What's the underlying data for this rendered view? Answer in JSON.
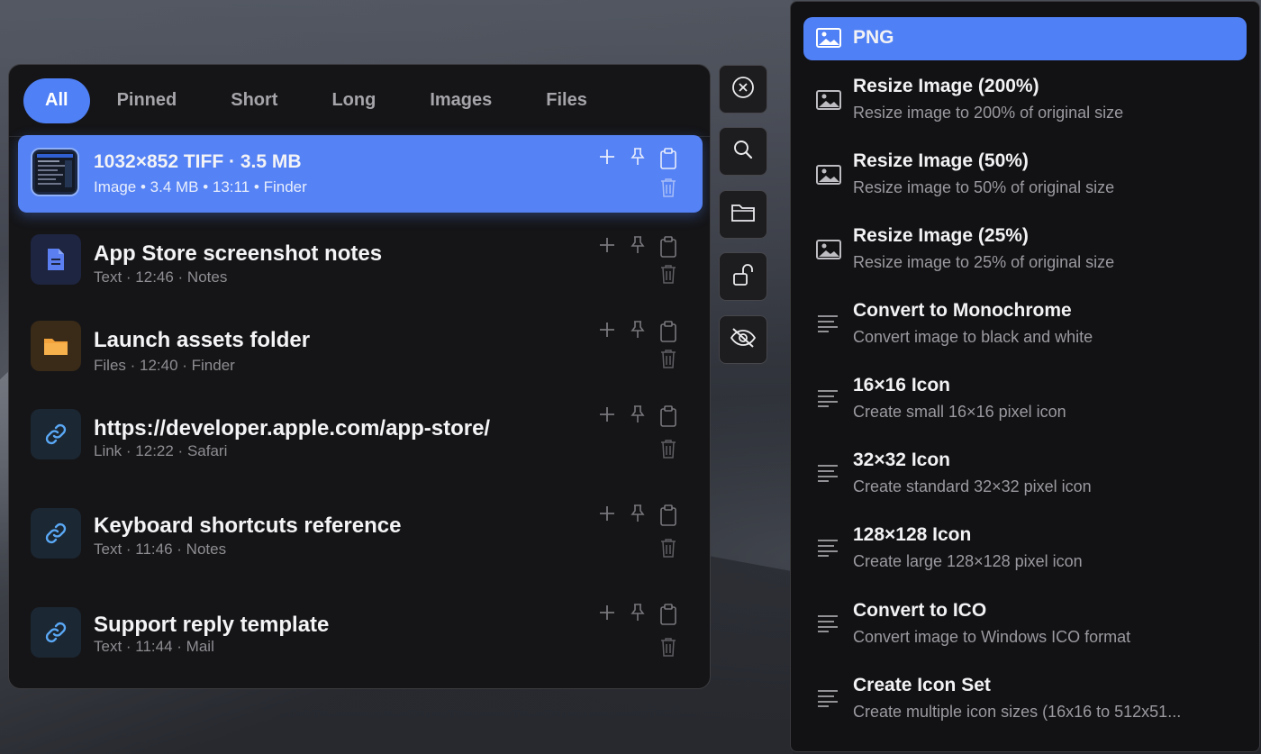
{
  "tabs": [
    "All",
    "Pinned",
    "Short",
    "Long",
    "Images",
    "Files"
  ],
  "items": [
    {
      "title": "1032×852 TIFF · 3.5 MB",
      "meta": "Image • 3.4 MB • 13:11 • Finder",
      "icon": "image-thumbnail-icon"
    },
    {
      "title": "App Store screenshot notes",
      "meta": "Text · 12:46 · Notes",
      "icon": "document-icon"
    },
    {
      "title": "Launch assets folder",
      "meta": "Files · 12:40 · Finder",
      "icon": "folder-icon"
    },
    {
      "title": "https://developer.apple.com/app-store/",
      "meta": "Link · 12:22 · Safari",
      "icon": "link-icon"
    },
    {
      "title": "Keyboard shortcuts reference",
      "meta": "Text · 11:46 · Notes",
      "icon": "link-icon"
    },
    {
      "title": "Support reply template",
      "meta": "Text · 11:44 · Mail",
      "icon": "link-icon"
    }
  ],
  "sidebar_buttons": [
    "close-circle-icon",
    "search-icon",
    "folder-icon",
    "unlock-icon",
    "eye-slash-icon"
  ],
  "menu": {
    "items": [
      {
        "title": "PNG",
        "desc": "",
        "icon": "image-icon"
      },
      {
        "title": "Resize Image (200%)",
        "desc": "Resize image to 200% of original size",
        "icon": "image-icon"
      },
      {
        "title": "Resize Image (50%)",
        "desc": "Resize image to 50% of original size",
        "icon": "image-icon"
      },
      {
        "title": "Resize Image (25%)",
        "desc": "Resize image to 25% of original size",
        "icon": "image-icon"
      },
      {
        "title": "Convert to Monochrome",
        "desc": "Convert image to black and white",
        "icon": "text-lines-icon"
      },
      {
        "title": "16×16 Icon",
        "desc": "Create small 16×16 pixel icon",
        "icon": "text-lines-icon"
      },
      {
        "title": "32×32 Icon",
        "desc": "Create standard 32×32 pixel icon",
        "icon": "text-lines-icon"
      },
      {
        "title": "128×128 Icon",
        "desc": "Create large 128×128 pixel icon",
        "icon": "text-lines-icon"
      },
      {
        "title": "Convert to ICO",
        "desc": "Convert image to Windows ICO format",
        "icon": "text-lines-icon"
      },
      {
        "title": "Create Icon Set",
        "desc": "Create multiple icon sizes (16x16 to 512x51...",
        "icon": "text-lines-icon"
      }
    ]
  },
  "colors": {
    "accent": "#4f80f6",
    "panel": "#151517",
    "folder": "#f3a33b",
    "link": "#5aa8f5",
    "doc": "#5b7ff0"
  }
}
